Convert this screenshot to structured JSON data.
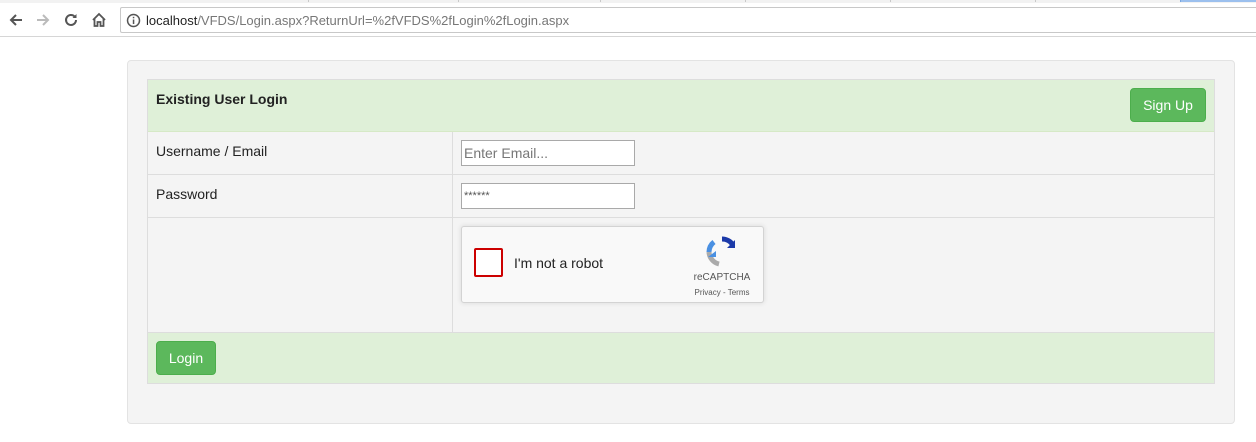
{
  "browser": {
    "url_host": "localhost",
    "url_path": "/VFDS/Login.aspx?ReturnUrl=%2fVFDS%2fLogin%2fLogin.aspx"
  },
  "form": {
    "title": "Existing User Login",
    "signup_label": "Sign Up",
    "username_label": "Username / Email",
    "username_placeholder": "Enter Email...",
    "password_label": "Password",
    "password_value": "******",
    "login_label": "Login"
  },
  "recaptcha": {
    "label": "I'm not a robot",
    "brand": "reCAPTCHA",
    "privacy": "Privacy",
    "separator": " - ",
    "terms": "Terms"
  },
  "colors": {
    "success": "#5cb85c",
    "header_bg": "#dff0d8",
    "checkbox_border": "#cc0000"
  }
}
